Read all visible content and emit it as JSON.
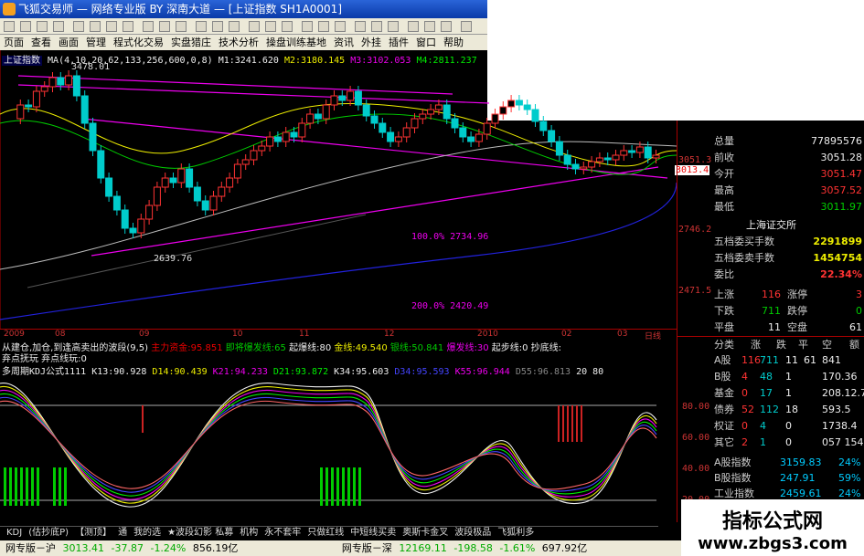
{
  "window": {
    "title": "飞狐交易师 — 网络专业版 BY 深南大道 — [上证指数 SH1A0001]"
  },
  "menu": [
    "页面",
    "查看",
    "画面",
    "管理",
    "程式化交易",
    "实盘猎庄",
    "技术分析",
    "操盘训练基地",
    "资讯",
    "外挂",
    "插件",
    "窗口",
    "帮助"
  ],
  "chart": {
    "symbol": "上证指数",
    "ma_text": "MA(4,10,20,62,133,256,600,0,8)",
    "m1": "M1:3241.620",
    "m2": "M2:3180.145",
    "m3": "M3:3102.053",
    "m4": "M4:2811.237",
    "high_label": "3478.01",
    "low_label": "2639.76",
    "fib1": "100.0% 2734.96",
    "fib2": "200.0% 2420.49",
    "ylabels": [
      "3051.3",
      "3013.4",
      "2746.2",
      "2471.5"
    ],
    "xlabels": [
      "2009",
      "08",
      "09",
      "10",
      "11",
      "12",
      "2010",
      "02",
      "03",
      "日线"
    ]
  },
  "indicator": {
    "line1_prefix": "从建仓,加仓,到逢高卖出的波段(9,5)",
    "line1_items": [
      {
        "text": "主力资金:95.851",
        "color": "#e00"
      },
      {
        "text": "即将爆发线:65",
        "color": "#0c0"
      },
      {
        "text": "起爆线:80",
        "color": "#eee"
      },
      {
        "text": "金线:49.540",
        "color": "#ee0"
      },
      {
        "text": "银线:50.841",
        "color": "#0c0"
      },
      {
        "text": "爆发线:30",
        "color": "#e0e"
      },
      {
        "text": "起步线:0",
        "color": "#eee"
      },
      {
        "text": "抄底线:",
        "color": "#eee"
      }
    ],
    "line2": "弃点抚玩    弃点线玩:0",
    "kdj_prefix": "多周期KDJ公式1111",
    "kdj_items": [
      {
        "text": "K13:90.928",
        "color": "#eee"
      },
      {
        "text": "D14:90.439",
        "color": "#ee0"
      },
      {
        "text": "K21:94.233",
        "color": "#e0e"
      },
      {
        "text": "D21:93.872",
        "color": "#0e0"
      },
      {
        "text": "K34:95.603",
        "color": "#eee"
      },
      {
        "text": "D34:95.593",
        "color": "#44f"
      },
      {
        "text": "K55:96.944",
        "color": "#e0e"
      },
      {
        "text": "D55:96.813",
        "color": "#888"
      },
      {
        "text": "20",
        "color": "#eee"
      },
      {
        "text": "80",
        "color": "#eee"
      }
    ],
    "kdj_ylabels": [
      "80.00",
      "60.00",
      "40.00",
      "20.00"
    ]
  },
  "quote": {
    "rows": [
      {
        "label": "总量",
        "value": "77895576",
        "color": "#eee"
      },
      {
        "label": "前收",
        "value": "3051.28",
        "color": "#eee"
      },
      {
        "label": "今开",
        "value": "3051.47",
        "color": "#f33"
      },
      {
        "label": "最高",
        "value": "3057.52",
        "color": "#f33"
      },
      {
        "label": "最低",
        "value": "3011.97",
        "color": "#0c0"
      }
    ],
    "exchange": "上海证交所",
    "rows2": [
      {
        "label": "五档委买手数",
        "value": "2291899",
        "color": "#ee0"
      },
      {
        "label": "五档委卖手数",
        "value": "1454754",
        "color": "#ee0"
      },
      {
        "label": "委比",
        "value": "22.34%",
        "color": "#f33"
      }
    ],
    "updown": [
      {
        "l1": "上涨",
        "v1": "116",
        "c1": "#f33",
        "l2": "涨停",
        "v2": "3",
        "c2": "#f33"
      },
      {
        "l1": "下跌",
        "v1": "711",
        "c1": "#0c0",
        "l2": "跌停",
        "v2": "0",
        "c2": "#0c0"
      },
      {
        "l1": "平盘",
        "v1": "11",
        "c1": "#eee",
        "l2": "空盘",
        "v2": "61",
        "c2": "#eee"
      }
    ],
    "table_head": [
      "分类",
      "涨",
      "跌",
      "平",
      "空",
      "额"
    ],
    "table": [
      {
        "cat": "A股",
        "up": "116",
        "down": "711",
        "flat": "11",
        "empty": "61",
        "amt": "841"
      },
      {
        "cat": "B股",
        "up": "4",
        "down": "48",
        "flat": "1",
        "empty": "",
        "amt": "170.36"
      },
      {
        "cat": "基金",
        "up": "0",
        "down": "17",
        "flat": "1",
        "empty": "",
        "amt": "208.12.7"
      },
      {
        "cat": "债券",
        "up": "52",
        "down": "112",
        "flat": "18",
        "empty": "",
        "amt": "593.5"
      },
      {
        "cat": "权证",
        "up": "0",
        "down": "4",
        "flat": "0",
        "empty": "",
        "amt": "1738.4"
      },
      {
        "cat": "其它",
        "up": "2",
        "down": "1",
        "flat": "0",
        "empty": "",
        "amt": "057 154"
      }
    ],
    "indices": [
      {
        "name": "A股指数",
        "value": "3159.83",
        "pct": "24%"
      },
      {
        "name": "B股指数",
        "value": "247.91",
        "pct": "59%"
      },
      {
        "name": "工业指数",
        "value": "2459.61",
        "pct": "24%"
      },
      {
        "name": "商业指数",
        "value": "3919.53",
        "pct": "15%"
      }
    ]
  },
  "tabs": [
    "KDJ",
    "(估抄底P)",
    "【测顶】",
    "通",
    "我的选",
    "★波段幻影 私募",
    "机构",
    "永不套牢",
    "只做红线",
    "中短线买卖",
    "奥斯卡金叉",
    "波段极品",
    "飞狐利多"
  ],
  "status": {
    "left_label": "网专版－沪",
    "left_value": "3013.41",
    "left_change": "-37.87",
    "left_pct": "-1.24%",
    "left_amt": "856.19亿",
    "right_label": "网专版－深",
    "right_value": "12169.11",
    "right_change": "-198.58",
    "right_pct": "-1.61%",
    "right_amt": "697.92亿"
  },
  "watermark": {
    "title": "指标公式网",
    "url": "www.zbgs3.com"
  },
  "colors": {
    "up": "#f33",
    "down": "#0cc",
    "bg": "#000",
    "axis": "#a00"
  }
}
